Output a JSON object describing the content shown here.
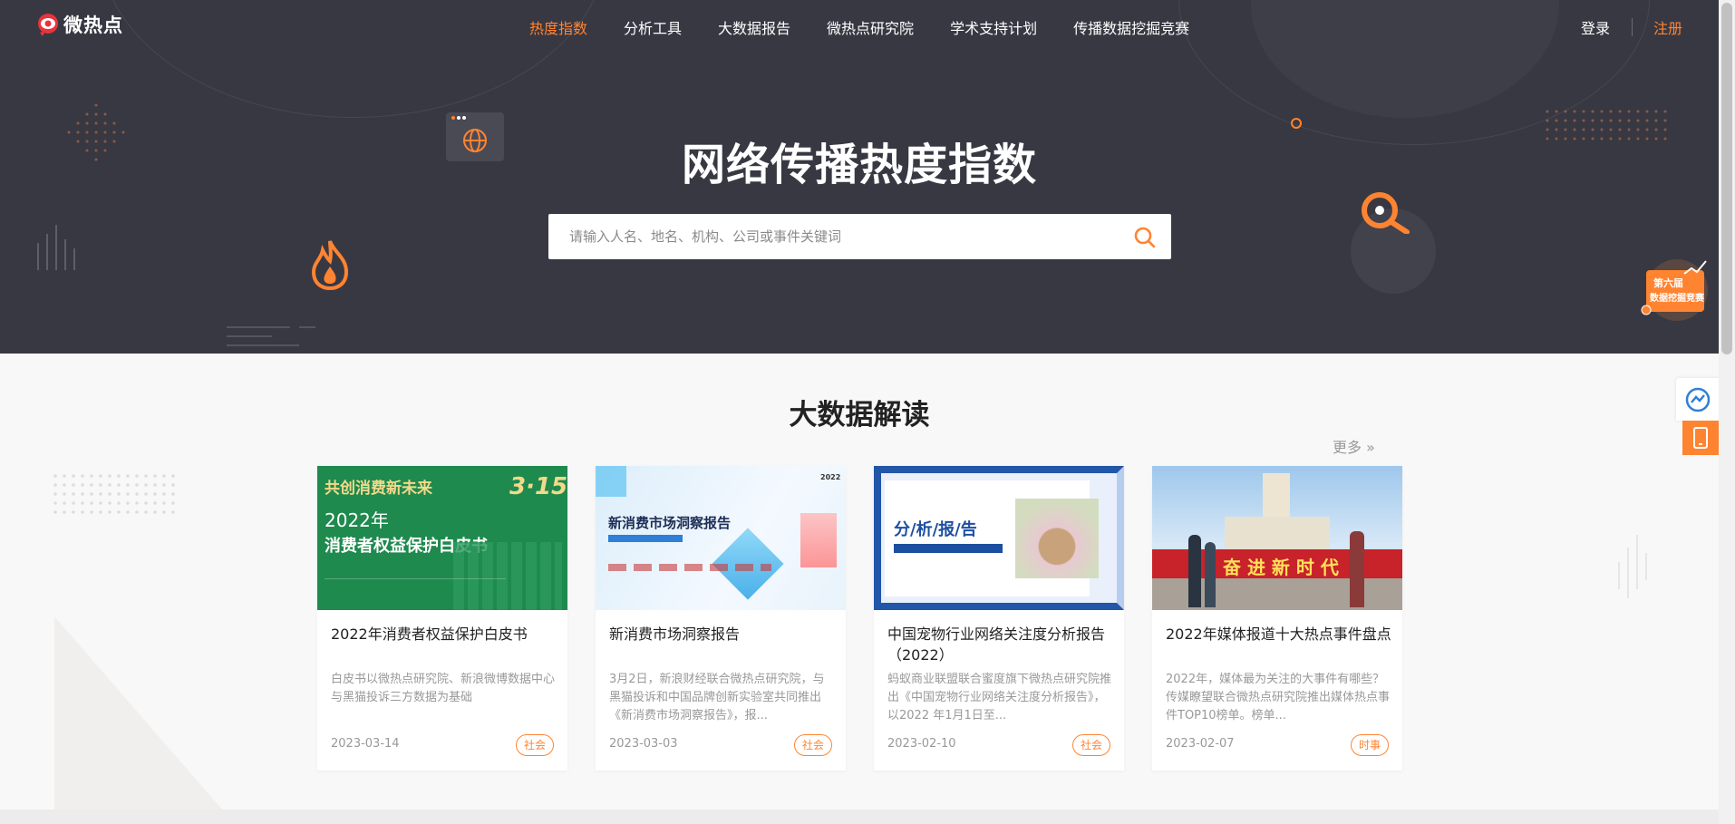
{
  "logo": {
    "text": "微热点"
  },
  "nav": {
    "items": [
      {
        "label": "热度指数",
        "active": true
      },
      {
        "label": "分析工具",
        "active": false
      },
      {
        "label": "大数据报告",
        "active": false
      },
      {
        "label": "微热点研究院",
        "active": false
      },
      {
        "label": "学术支持计划",
        "active": false
      },
      {
        "label": "传播数据挖掘竞赛",
        "active": false
      }
    ]
  },
  "auth": {
    "login": "登录",
    "register": "注册"
  },
  "hero": {
    "title": "网络传播热度指数",
    "search_placeholder": "请输入人名、地名、机构、公司或事件关键词"
  },
  "section": {
    "title": "大数据解读",
    "more": "更多"
  },
  "cards": [
    {
      "title": "2022年消费者权益保护白皮书",
      "desc": "白皮书以微热点研究院、新浪微博数据中心与黑猫投诉三方数据为基础",
      "date": "2023-03-14",
      "tag": "社会",
      "thumb": {
        "line1": "共创消费新未来",
        "year": "2022年",
        "line2": "消费者权益保护白皮书",
        "badge": "3·15"
      }
    },
    {
      "title": "新消费市场洞察报告",
      "desc": "3月2日，新浪财经联合微热点研究院，与黑猫投诉和中国品牌创新实验室共同推出《新消费市场洞察报告》，报...",
      "date": "2023-03-03",
      "tag": "社会",
      "thumb": {
        "line1": "新消费市场洞察报告",
        "year": "2022"
      }
    },
    {
      "title": "中国宠物行业网络关注度分析报告（2022）",
      "desc": "蚂蚁商业联盟联合蜜度旗下微热点研究院推出《中国宠物行业网络关注度分析报告》，以2022 年1月1日至...",
      "date": "2023-02-10",
      "tag": "社会",
      "thumb": {
        "line1": "分/析/报/告"
      }
    },
    {
      "title": "2022年媒体报道十大热点事件盘点",
      "desc": "2022年，媒体最为关注的大事件有哪些？传媒瞭望联合微热点研究院推出媒体热点事件TOP10榜单。榜单...",
      "date": "2023-02-07",
      "tag": "时事",
      "thumb": {
        "line1": "奋 进 新 时 代"
      }
    }
  ],
  "colors": {
    "accent": "#ff8431",
    "hero_bg": "#383843"
  }
}
